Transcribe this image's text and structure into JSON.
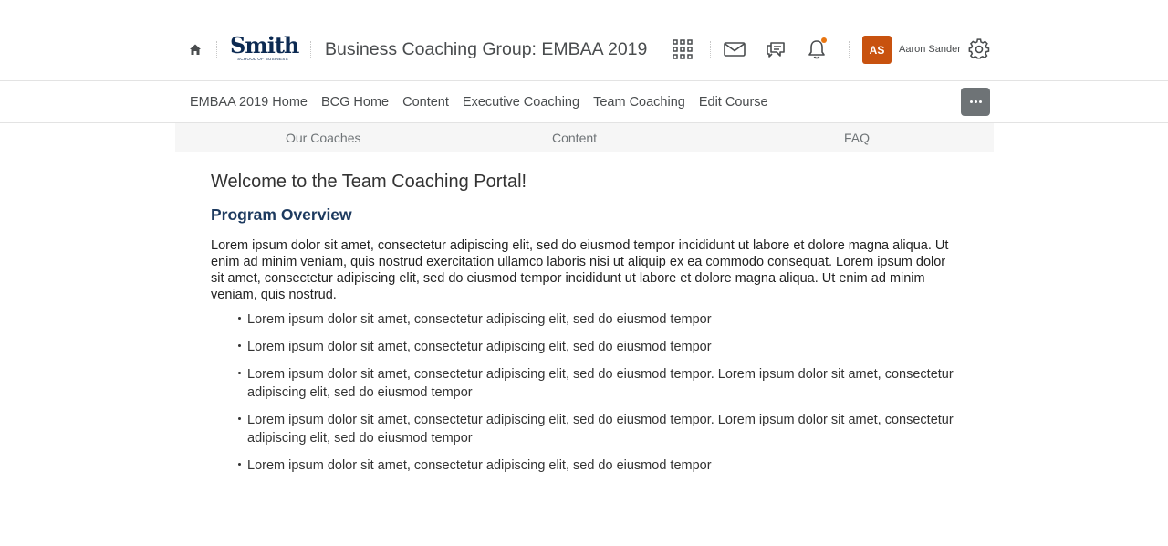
{
  "header": {
    "logo_text": "Smith",
    "logo_subtext": "SCHOOL OF BUSINESS",
    "course_title": "Business Coaching Group: EMBAA 2019",
    "user_initials": "AS",
    "user_name": "Aaron Sander",
    "notification_dot_color": "#e87511",
    "avatar_color": "#c8520f",
    "icons": [
      "home-icon",
      "grid-icon",
      "mail-icon",
      "chat-icon",
      "bell-icon",
      "gear-icon"
    ]
  },
  "nav": {
    "items": [
      {
        "label": "EMBAA 2019 Home"
      },
      {
        "label": "BCG Home"
      },
      {
        "label": "Content"
      },
      {
        "label": "Executive Coaching"
      },
      {
        "label": "Team Coaching"
      },
      {
        "label": "Edit Course"
      }
    ]
  },
  "subtabs": {
    "items": [
      {
        "label": "Our Coaches"
      },
      {
        "label": "Content"
      },
      {
        "label": "FAQ"
      }
    ]
  },
  "main": {
    "heading": "Welcome to the Team Coaching Portal!",
    "subheading": "Program Overview",
    "paragraph": "Lorem ipsum dolor sit amet, consectetur adipiscing elit, sed do eiusmod tempor incididunt ut labore et dolore magna aliqua. Ut enim ad minim veniam, quis nostrud exercitation ullamco laboris nisi ut aliquip ex ea commodo consequat. Lorem ipsum dolor sit amet, consectetur adipiscing elit, sed do eiusmod tempor incididunt ut labore et dolore magna aliqua. Ut enim ad minim veniam, quis nostrud.",
    "bullets": [
      "Lorem ipsum dolor sit amet, consectetur adipiscing elit, sed do eiusmod tempor",
      "Lorem ipsum dolor sit amet, consectetur adipiscing elit, sed do eiusmod tempor",
      "Lorem ipsum dolor sit amet, consectetur adipiscing elit, sed do eiusmod tempor. Lorem ipsum dolor sit amet, consectetur adipiscing elit, sed do eiusmod tempor",
      "Lorem ipsum dolor sit amet, consectetur adipiscing elit, sed do eiusmod tempor. Lorem ipsum dolor sit amet, consectetur adipiscing elit, sed do eiusmod tempor",
      "Lorem ipsum dolor sit amet, consectetur adipiscing elit, sed do eiusmod tempor"
    ]
  }
}
